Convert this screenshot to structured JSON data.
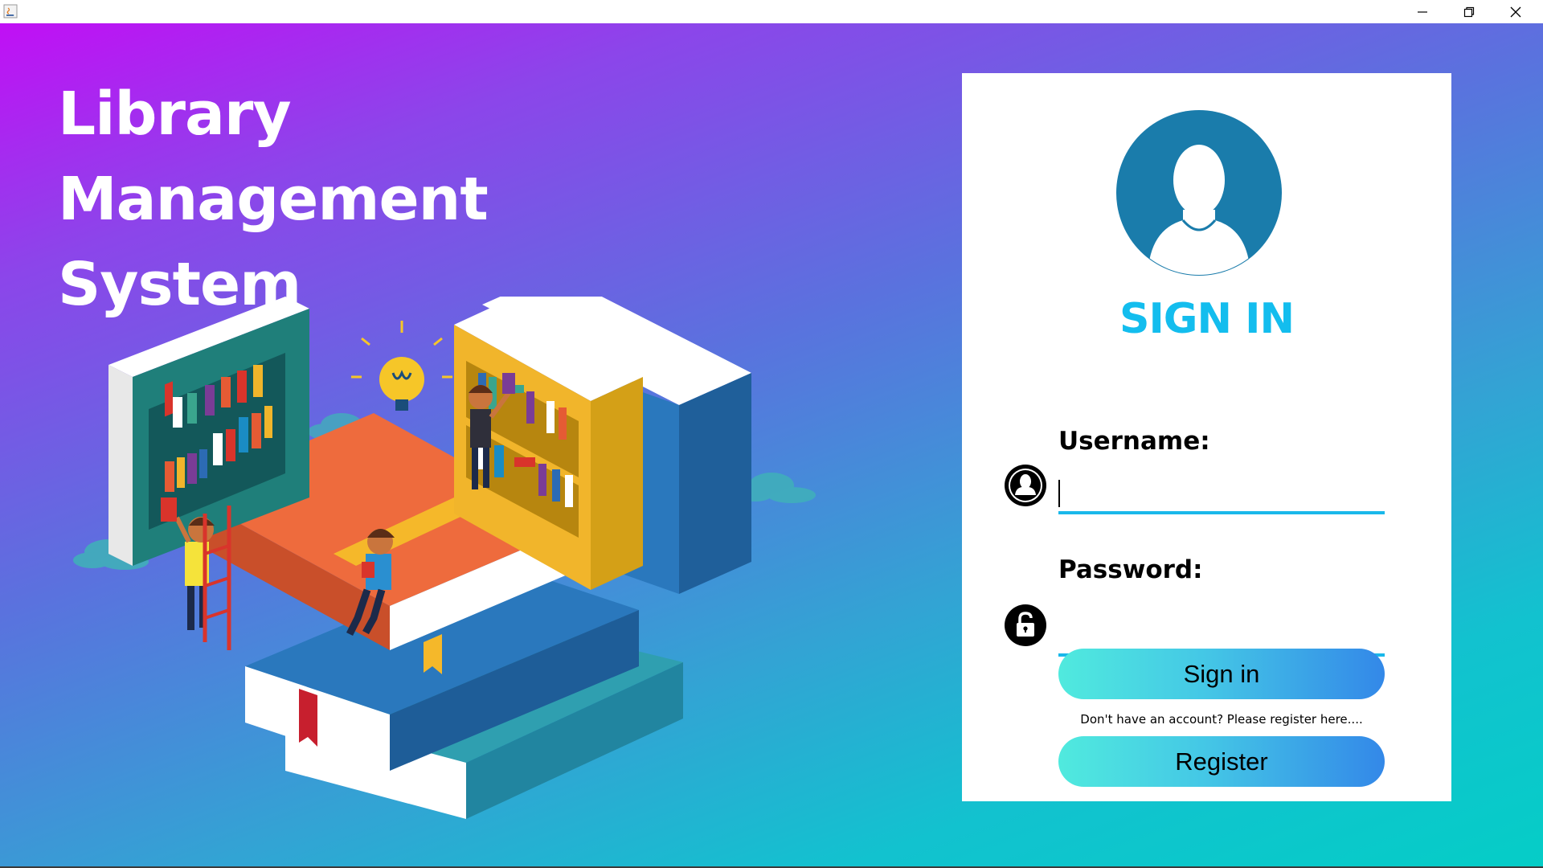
{
  "window": {
    "controls": {
      "minimize": "minimize-icon",
      "restore": "restore-icon",
      "close": "close-icon"
    }
  },
  "app": {
    "title_line1": "Library Management",
    "title_line2": "System"
  },
  "signin": {
    "heading": "SIGN IN",
    "username_label": "Username:",
    "username_value": "",
    "password_label": "Password:",
    "password_value": "",
    "signin_button": "Sign in",
    "register_hint": "Don't have an account? Please register here....",
    "register_button": "Register"
  },
  "colors": {
    "gradient_start": "#c10ff5",
    "gradient_end": "#05cdc7",
    "heading": "#13bdee",
    "underline": "#19b8ea",
    "avatar": "#1a7cab",
    "button_start": "#50eade",
    "button_end": "#3388e8"
  }
}
